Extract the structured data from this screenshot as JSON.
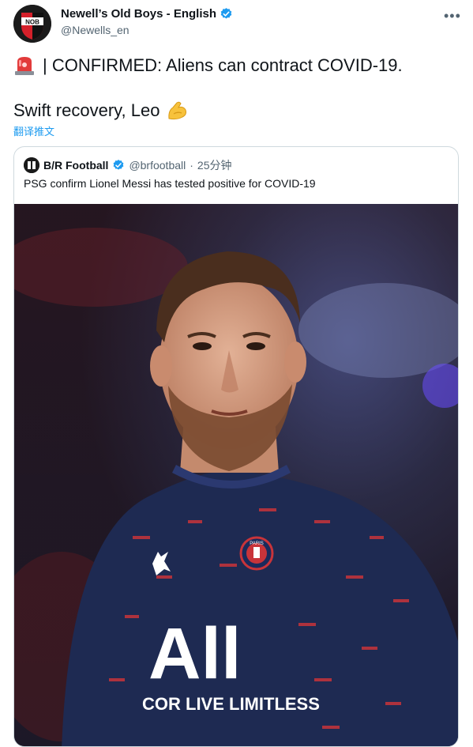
{
  "tweet": {
    "author_name": "Newell’s Old Boys - English",
    "author_handle": "@Newells_en",
    "avatar_text": "NOB",
    "line1_prefix": "| CONFIRMED: Aliens can contract COVID-19.",
    "line2": "Swift recovery, Leo",
    "translate_label": "翻译推文",
    "more_label": "•••"
  },
  "quoted": {
    "name": "B/R Football",
    "handle": "@brfootball",
    "separator": "·",
    "time": "25分钟",
    "text": "PSG confirm Lionel Messi has tested positive for COVID-19",
    "shirt_slogan": "COR LIVE LIMITLESS",
    "shirt_big": "All",
    "badge_text": "PARIS"
  },
  "icons": {
    "verified": "verified-badge-icon",
    "siren": "rotating-light-emoji-icon",
    "flex": "flexed-biceps-emoji-icon"
  },
  "colors": {
    "accent": "#1d9bf0",
    "text": "#0f1419",
    "muted": "#536471",
    "border": "#cfd9de",
    "psg_navy": "#1e2a52"
  }
}
